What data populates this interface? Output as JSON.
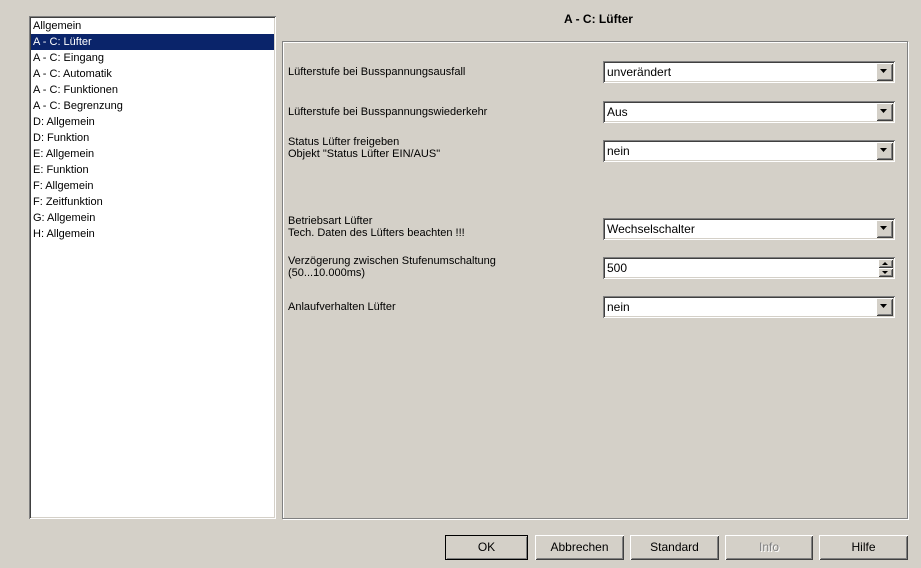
{
  "nav": {
    "items": [
      {
        "label": "Allgemein",
        "selected": false
      },
      {
        "label": "A - C: Lüfter",
        "selected": true
      },
      {
        "label": "A - C: Eingang",
        "selected": false
      },
      {
        "label": "A - C: Automatik",
        "selected": false
      },
      {
        "label": "A - C: Funktionen",
        "selected": false
      },
      {
        "label": "A - C: Begrenzung",
        "selected": false
      },
      {
        "label": "D: Allgemein",
        "selected": false
      },
      {
        "label": "D: Funktion",
        "selected": false
      },
      {
        "label": "E: Allgemein",
        "selected": false
      },
      {
        "label": "E: Funktion",
        "selected": false
      },
      {
        "label": "F: Allgemein",
        "selected": false
      },
      {
        "label": "F: Zeitfunktion",
        "selected": false
      },
      {
        "label": "G: Allgemein",
        "selected": false
      },
      {
        "label": "H: Allgemein",
        "selected": false
      }
    ]
  },
  "page": {
    "title": "A - C: Lüfter"
  },
  "params": {
    "p1": {
      "label": "Lüfterstufe bei Busspannungsausfall",
      "value": "unverändert"
    },
    "p2": {
      "label": "Lüfterstufe bei Busspannungswiederkehr",
      "value": "Aus"
    },
    "p3": {
      "label_line1": "Status Lüfter freigeben",
      "label_line2": "Objekt \"Status Lüfter EIN/AUS\"",
      "value": "nein"
    },
    "p4": {
      "label_line1": "Betriebsart Lüfter",
      "label_line2": "Tech. Daten des Lüfters beachten !!!",
      "value": "Wechselschalter"
    },
    "p5": {
      "label_line1": "Verzögerung zwischen Stufenumschaltung",
      "label_line2": "(50...10.000ms)",
      "value": "500"
    },
    "p6": {
      "label": "Anlaufverhalten Lüfter",
      "value": "nein"
    }
  },
  "buttons": {
    "ok": "OK",
    "cancel": "Abbrechen",
    "standard": "Standard",
    "info": "Info",
    "help": "Hilfe"
  }
}
